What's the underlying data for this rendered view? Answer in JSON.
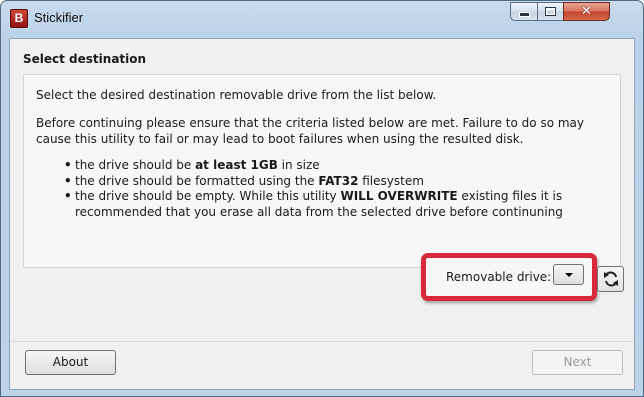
{
  "window": {
    "title": "Stickifier",
    "app_icon_letter": "B",
    "controls": {
      "minimize": "minimize",
      "maximize": "maximize",
      "close": "✕"
    }
  },
  "page": {
    "title": "Select destination",
    "intro": "Select the desired destination removable drive from the list below.",
    "warning": "Before continuing please ensure that the criteria listed below are met. Failure to do so may cause this utility to fail or may lead to boot failures when using the resulted disk."
  },
  "criteria": [
    {
      "pre": "the drive should be ",
      "bold": "at least 1GB",
      "post": " in size"
    },
    {
      "pre": "the drive should be formatted using the ",
      "bold": "FAT32",
      "post": " filesystem"
    },
    {
      "pre": "the drive should be empty. While this utility ",
      "bold": "WILL OVERWRITE",
      "post": " existing files it is recommended that you erase all data from the selected drive before continuning"
    }
  ],
  "drive_selector": {
    "label": "Removable drive:",
    "selected": "",
    "highlight_color": "#d8283c"
  },
  "footer": {
    "about_label": "About",
    "next_label": "Next",
    "next_enabled": false
  }
}
